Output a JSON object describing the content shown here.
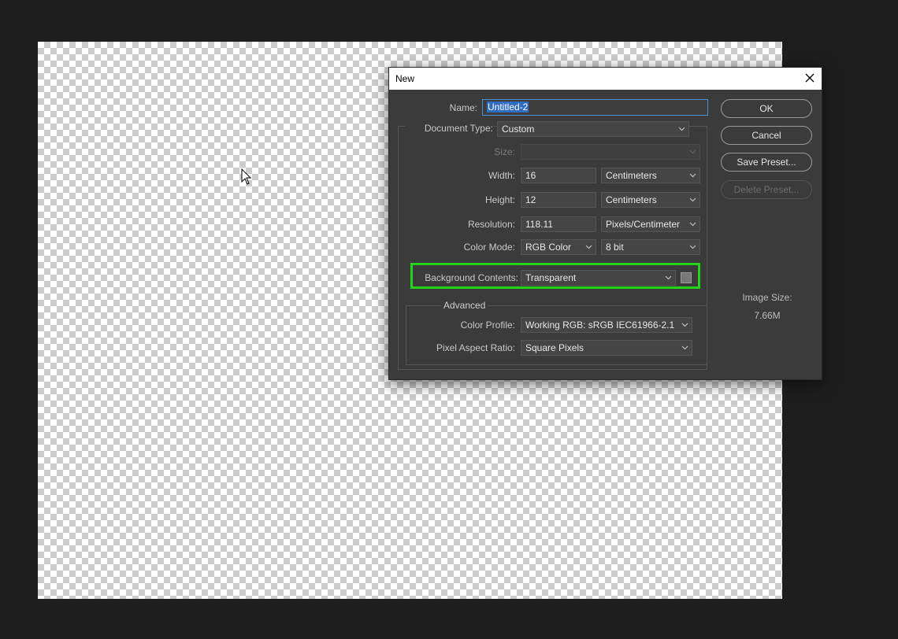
{
  "dialog": {
    "title": "New",
    "name_label": "Name:",
    "name_value": "Untitled-2",
    "doc_type_label": "Document Type:",
    "doc_type_value": "Custom",
    "size_label": "Size:",
    "size_value": "",
    "width_label": "Width:",
    "width_value": "16",
    "width_unit": "Centimeters",
    "height_label": "Height:",
    "height_value": "12",
    "height_unit": "Centimeters",
    "resolution_label": "Resolution:",
    "resolution_value": "118.11",
    "resolution_unit": "Pixels/Centimeter",
    "color_mode_label": "Color Mode:",
    "color_mode_value": "RGB Color",
    "bit_depth_value": "8 bit",
    "background_label": "Background Contents:",
    "background_value": "Transparent",
    "advanced_label": "Advanced",
    "color_profile_label": "Color Profile:",
    "color_profile_value": "Working RGB:  sRGB IEC61966-2.1",
    "pixel_aspect_label": "Pixel Aspect Ratio:",
    "pixel_aspect_value": "Square Pixels",
    "buttons": {
      "ok": "OK",
      "cancel": "Cancel",
      "save_preset": "Save Preset...",
      "delete_preset": "Delete Preset..."
    },
    "image_size_label": "Image Size:",
    "image_size_value": "7.66M"
  },
  "colors": {
    "highlight": "#22d31a",
    "dialog_bg": "#3b3b3b",
    "selection": "#2f6cc2"
  }
}
